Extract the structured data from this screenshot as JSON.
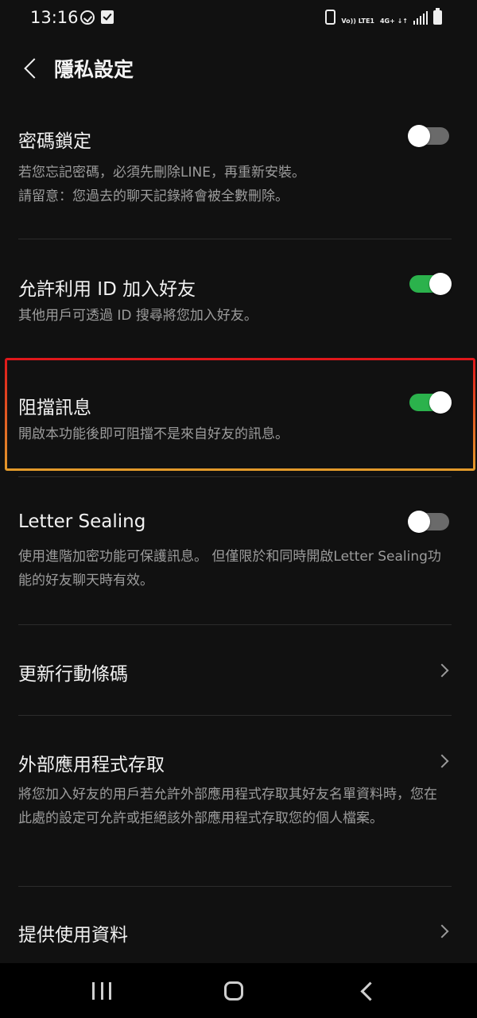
{
  "status_bar": {
    "time": "13:16",
    "volte": "Vo)) LTE1",
    "network": "4G+ ↓↑"
  },
  "header": {
    "title": "隱私設定"
  },
  "settings": [
    {
      "title": "密碼鎖定",
      "desc": "若您忘記密碼，必須先刪除LINE，再重新安裝。\n請留意：您過去的聊天記錄將會被全數刪除。",
      "control": "toggle",
      "enabled": false
    },
    {
      "title": "允許利用 ID 加入好友",
      "desc": "其他用戶可透過 ID 搜尋將您加入好友。",
      "control": "toggle",
      "enabled": true
    },
    {
      "title": "阻擋訊息",
      "desc": "開啟本功能後即可阻擋不是來自好友的訊息。",
      "control": "toggle",
      "enabled": true
    },
    {
      "title": "Letter Sealing",
      "desc": "使用進階加密功能可保護訊息。 但僅限於和同時開啟Letter Sealing功能的好友聊天時有效。",
      "control": "toggle",
      "enabled": false
    },
    {
      "title": "更新行動條碼",
      "desc": "",
      "control": "chevron"
    },
    {
      "title": "外部應用程式存取",
      "desc": "將您加入好友的用戶若允許外部應用程式存取其好友名單資料時，您在此處的設定可允許或拒絕該外部應用程式存取您的個人檔案。",
      "control": "chevron"
    },
    {
      "title": "提供使用資料",
      "desc": "",
      "control": "chevron"
    }
  ],
  "colors": {
    "background": "#111111",
    "toggle_on": "#2bb24c",
    "toggle_off": "#6a6a6a",
    "highlight_top": "#e0161b",
    "highlight_bottom": "#e39b2a"
  }
}
